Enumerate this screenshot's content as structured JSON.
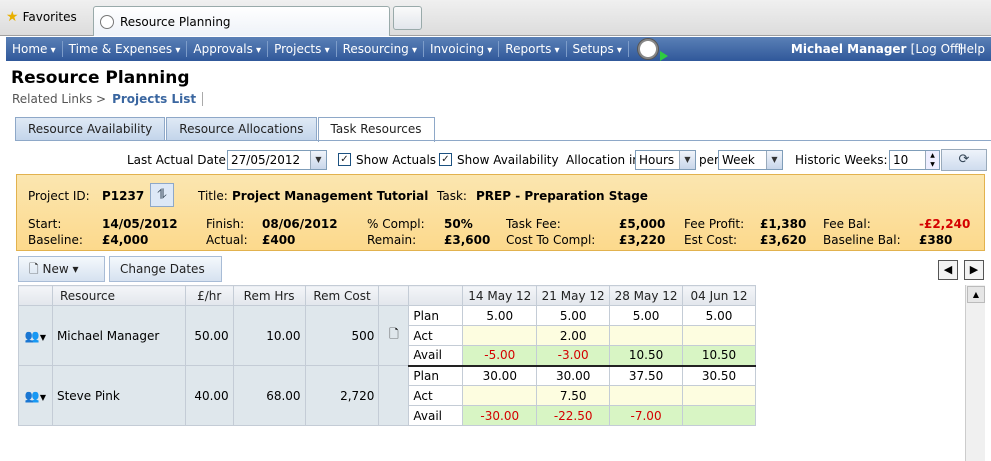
{
  "browser": {
    "favorites_label": "Favorites",
    "tab_title": "Resource Planning"
  },
  "nav": {
    "items": [
      "Home",
      "Time & Expenses",
      "Approvals",
      "Projects",
      "Resourcing",
      "Invoicing",
      "Reports",
      "Setups"
    ],
    "user": "Michael Manager",
    "logoff": "[Log Off]",
    "help": "Help"
  },
  "page": {
    "title": "Resource Planning",
    "related_links": "Related Links >",
    "projects_list": "Projects List"
  },
  "tabs": [
    "Resource Availability",
    "Resource Allocations",
    "Task Resources"
  ],
  "filters": {
    "last_actual_label": "Last Actual Date:",
    "last_actual_value": "27/05/2012",
    "show_actuals": "Show Actuals",
    "show_availability": "Show Availability",
    "allocation_label": "Allocation in",
    "allocation_value": "Hours",
    "per_label": "per",
    "per_value": "Week",
    "historic_label": "Historic Weeks:",
    "historic_value": "10"
  },
  "project": {
    "project_id_label": "Project ID:",
    "project_id": "P1237",
    "title_label": "Title:",
    "title": "Project Management Tutorial",
    "task_label": "Task:",
    "task": "PREP - Preparation Stage",
    "start_label": "Start:",
    "start": "14/05/2012",
    "finish_label": "Finish:",
    "finish": "08/06/2012",
    "compl_label": "% Compl:",
    "compl": "50%",
    "task_fee_label": "Task Fee:",
    "task_fee": "£5,000",
    "fee_profit_label": "Fee Profit:",
    "fee_profit": "£1,380",
    "fee_bal_label": "Fee Bal:",
    "fee_bal": "-£2,240",
    "baseline_label": "Baseline:",
    "baseline": "£4,000",
    "actual_label": "Actual:",
    "actual": "£400",
    "remain_label": "Remain:",
    "remain": "£3,600",
    "cost_to_compl_label": "Cost To Compl:",
    "cost_to_compl": "£3,220",
    "est_cost_label": "Est Cost:",
    "est_cost": "£3,620",
    "baseline_bal_label": "Baseline Bal:",
    "baseline_bal": "£380"
  },
  "toolbar": {
    "new_label": "New",
    "change_dates_label": "Change Dates"
  },
  "grid": {
    "headers": [
      "Resource",
      "£/hr",
      "Rem Hrs",
      "Rem Cost"
    ],
    "weeks": [
      "14 May 12",
      "21 May 12",
      "28 May 12",
      "04 Jun 12"
    ],
    "row_types": [
      "Plan",
      "Act",
      "Avail"
    ],
    "resources": [
      {
        "name": "Michael Manager",
        "rate": "50.00",
        "rem_hrs": "10.00",
        "rem_cost": "500",
        "plan": [
          "5.00",
          "5.00",
          "5.00",
          "5.00"
        ],
        "act": [
          "",
          "2.00",
          "",
          ""
        ],
        "avail": [
          "-5.00",
          "-3.00",
          "10.50",
          "10.50"
        ]
      },
      {
        "name": "Steve Pink",
        "rate": "40.00",
        "rem_hrs": "68.00",
        "rem_cost": "2,720",
        "plan": [
          "30.00",
          "30.00",
          "37.50",
          "30.50"
        ],
        "act": [
          "",
          "7.50",
          "",
          ""
        ],
        "avail": [
          "-30.00",
          "-22.50",
          "-7.00",
          ""
        ]
      }
    ]
  }
}
